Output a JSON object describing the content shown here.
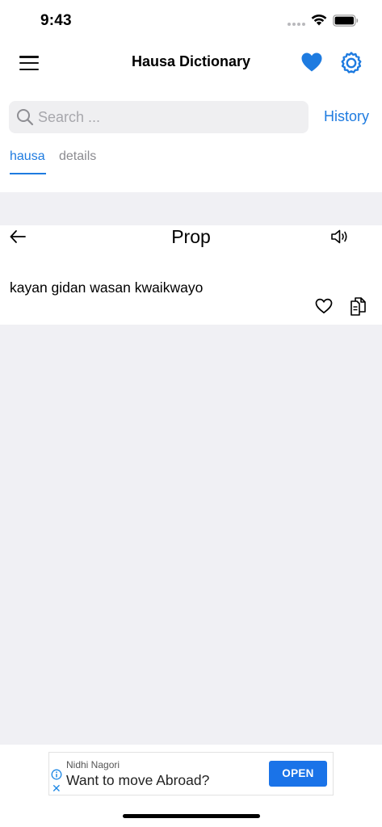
{
  "status_bar": {
    "time": "9:43"
  },
  "header": {
    "title": "Hausa Dictionary"
  },
  "search": {
    "placeholder": "Search ...",
    "value": "",
    "history_label": "History"
  },
  "tabs": [
    {
      "label": "hausa",
      "active": true
    },
    {
      "label": "details",
      "active": false
    }
  ],
  "entry": {
    "word": "Prop",
    "definition": "kayan gidan wasan kwaikwayo"
  },
  "ad": {
    "advertiser": "Nidhi Nagori",
    "headline": "Want to move Abroad?",
    "cta": "OPEN"
  },
  "colors": {
    "accent": "#1e7be0",
    "background": "#f0f0f4",
    "ad_button": "#1a73e8"
  },
  "icons": [
    "menu-icon",
    "heart-icon",
    "settings-icon",
    "search-icon",
    "back-arrow-icon",
    "speaker-icon",
    "heart-outline-icon",
    "copy-icon",
    "info-icon",
    "close-icon"
  ]
}
